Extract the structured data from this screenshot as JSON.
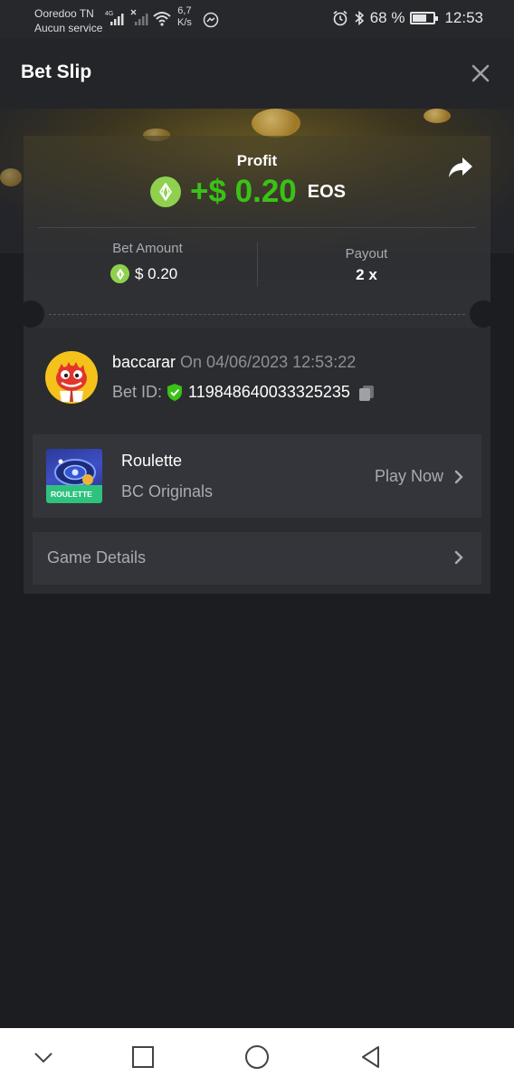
{
  "status_bar": {
    "carrier": "Ooredoo TN",
    "service": "Aucun service",
    "network_type": "4G",
    "net_speed_value": "6,7",
    "net_speed_unit": "K/s",
    "battery": "68 %",
    "battery_level": 0.68,
    "time": "12:53"
  },
  "header": {
    "title": "Bet Slip"
  },
  "profit": {
    "label": "Profit",
    "value": "+$ 0.20",
    "currency": "EOS"
  },
  "stats": {
    "bet_amount_label": "Bet Amount",
    "bet_amount_value": "$ 0.20",
    "payout_label": "Payout",
    "payout_value": "2 x"
  },
  "bet": {
    "username": "baccarar",
    "on_text": "On 04/06/2023 12:53:22",
    "bet_id_label": "Bet ID:",
    "bet_id": "119848640033325235"
  },
  "game": {
    "name": "Roulette",
    "provider": "BC Originals",
    "thumb_text": "ROULETTE",
    "play_label": "Play Now"
  },
  "details": {
    "label": "Game Details"
  },
  "colors": {
    "accent_green": "#3bc117",
    "eos_coin": "#8fd14f",
    "background": "#1c1d20"
  }
}
